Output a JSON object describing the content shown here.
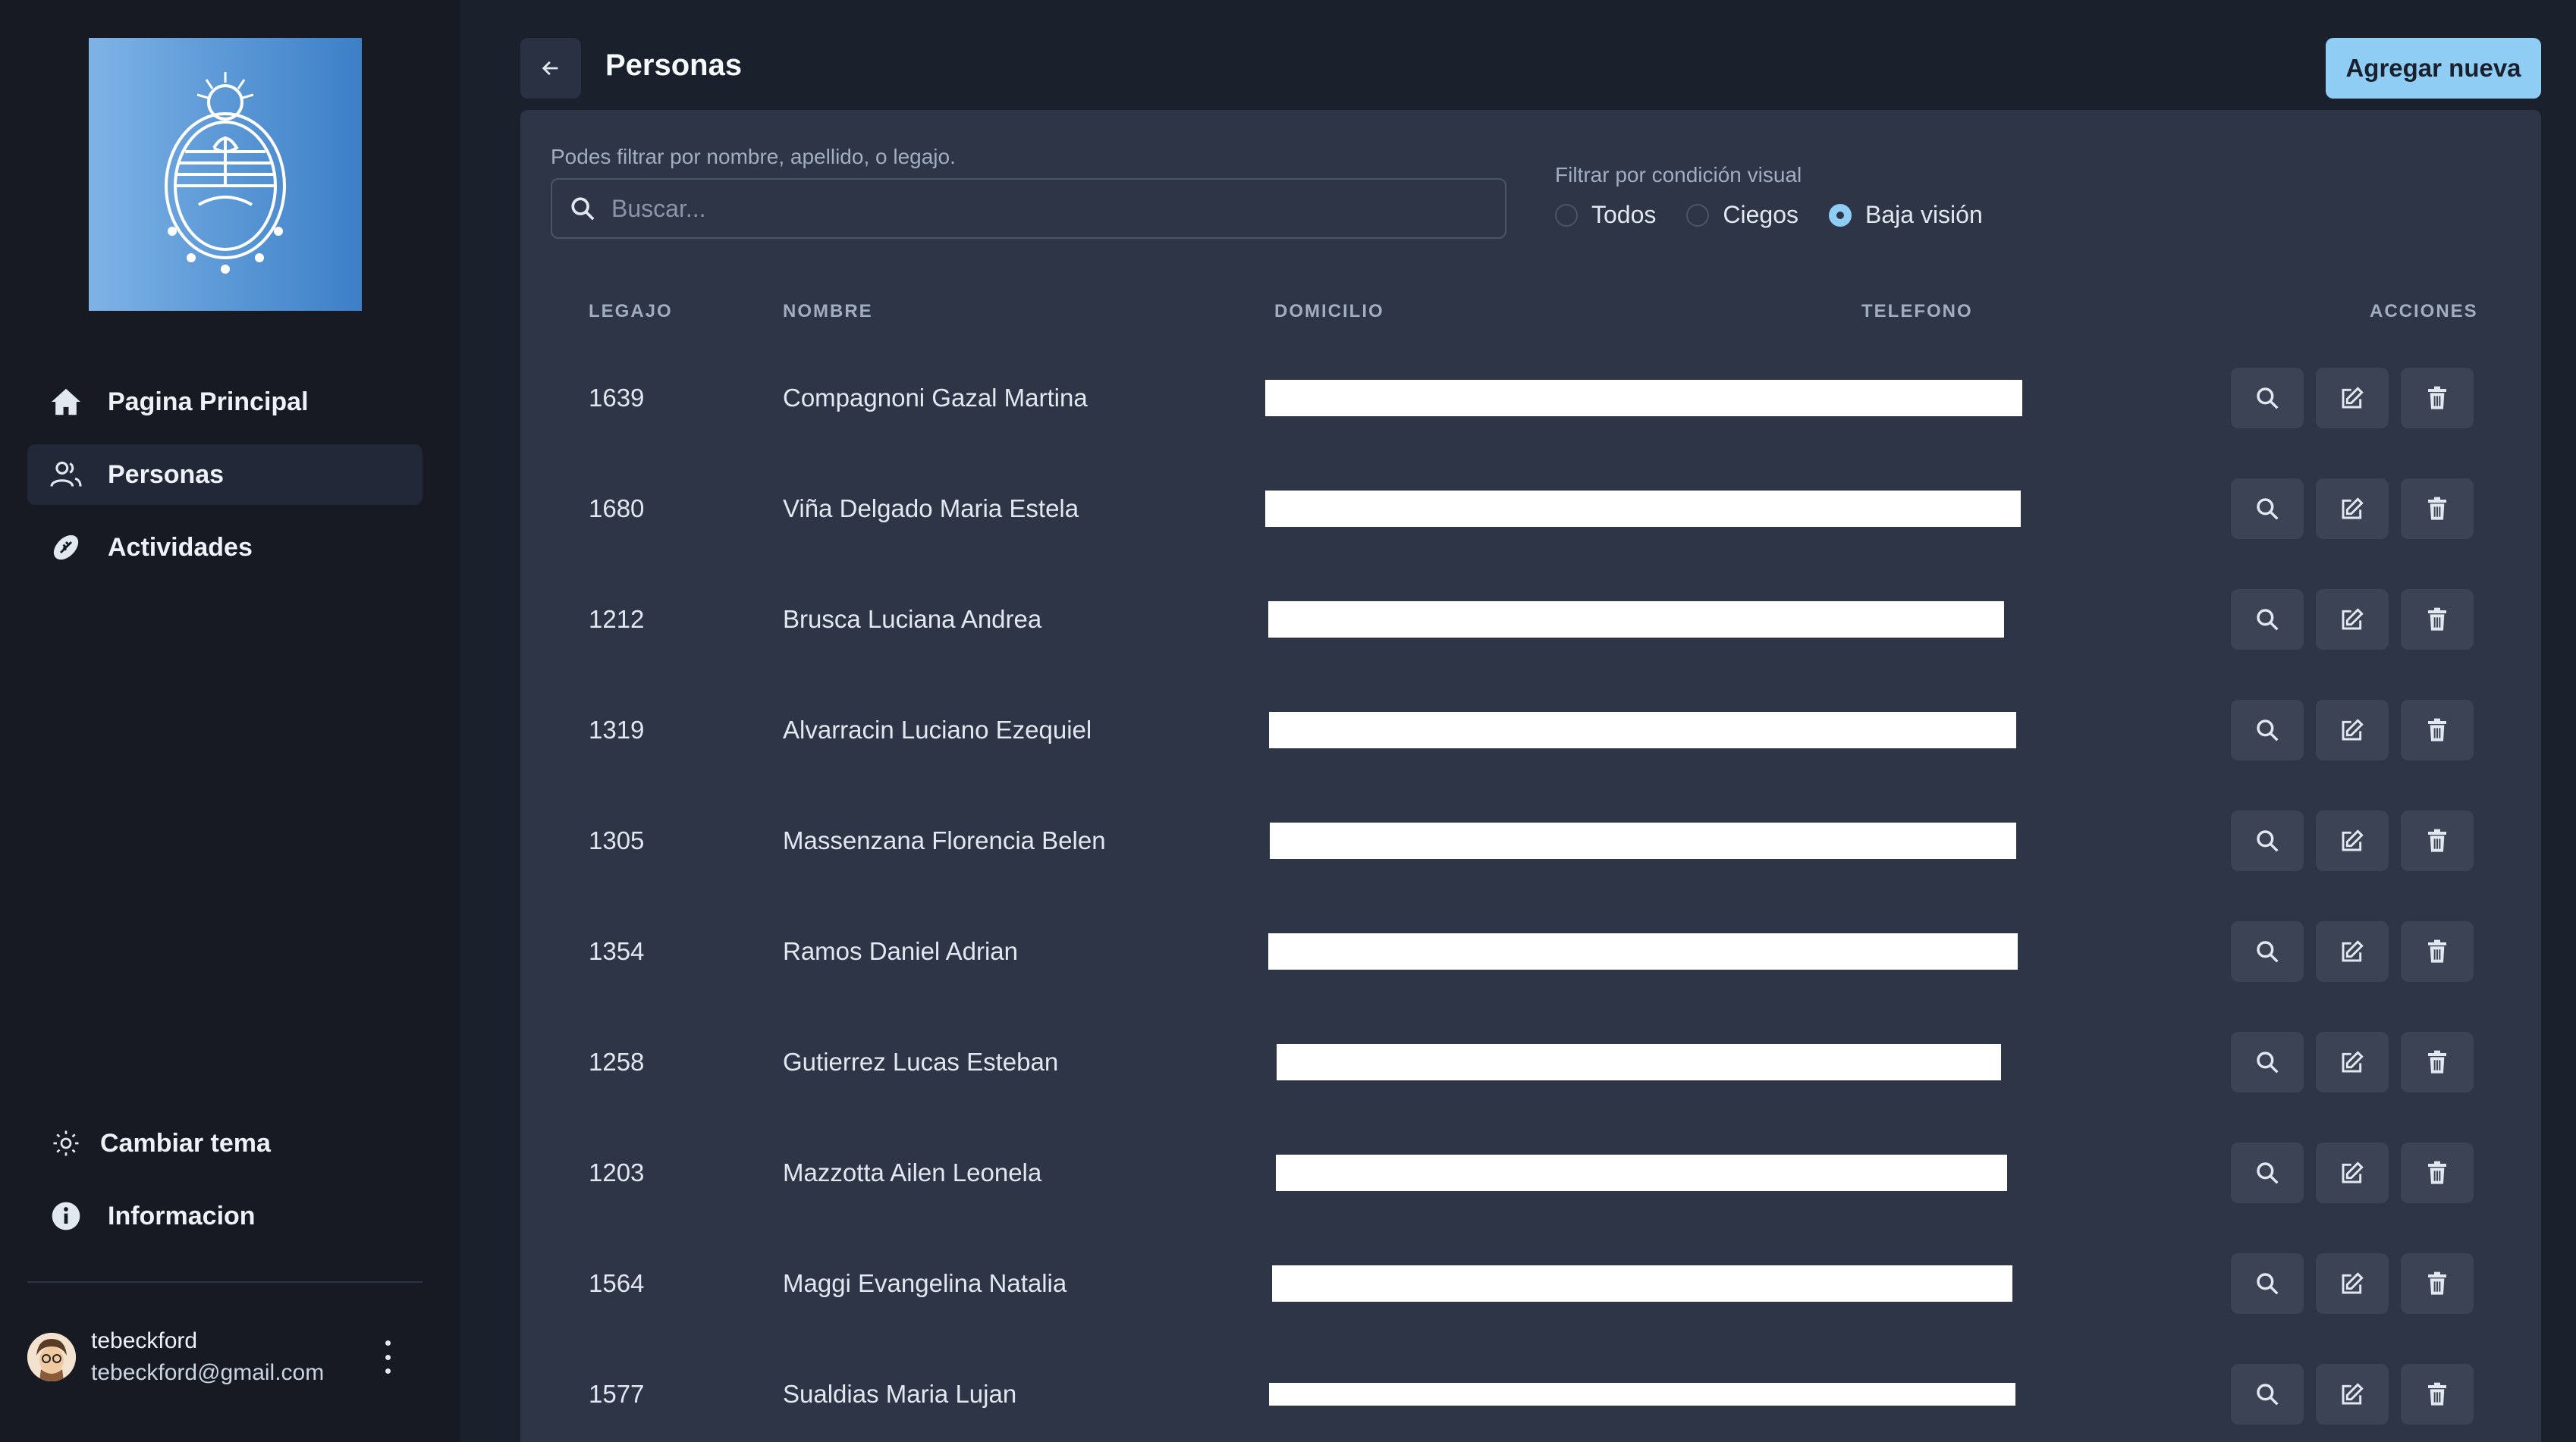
{
  "sidebar": {
    "nav": [
      {
        "label": "Pagina Principal",
        "icon": "home-icon",
        "active": false
      },
      {
        "label": "Personas",
        "icon": "users-icon",
        "active": true
      },
      {
        "label": "Actividades",
        "icon": "football-icon",
        "active": false
      }
    ],
    "bottom": [
      {
        "label": "Cambiar tema",
        "icon": "sun-icon"
      },
      {
        "label": "Informacion",
        "icon": "info-icon"
      }
    ],
    "user": {
      "name": "tebeckford",
      "email": "tebeckford@gmail.com"
    }
  },
  "header": {
    "title": "Personas",
    "add_label": "Agregar nueva"
  },
  "filters": {
    "hint": "Podes filtrar por nombre, apellido, o legajo.",
    "search_placeholder": "Buscar...",
    "visual_label": "Filtrar por condición visual",
    "options": [
      {
        "label": "Todos",
        "checked": false
      },
      {
        "label": "Ciegos",
        "checked": false
      },
      {
        "label": "Baja visión",
        "checked": true
      }
    ]
  },
  "table": {
    "columns": {
      "legajo": "LEGAJO",
      "nombre": "NOMBRE",
      "domicilio": "DOMICILIO",
      "telefono": "TELEFONO",
      "acciones": "ACCIONES"
    },
    "rows": [
      {
        "legajo": "1639",
        "nombre": "Compagnoni Gazal Martina"
      },
      {
        "legajo": "1680",
        "nombre": "Viña Delgado Maria Estela"
      },
      {
        "legajo": "1212",
        "nombre": "Brusca Luciana Andrea"
      },
      {
        "legajo": "1319",
        "nombre": "Alvarracin Luciano Ezequiel"
      },
      {
        "legajo": "1305",
        "nombre": "Massenzana Florencia Belen"
      },
      {
        "legajo": "1354",
        "nombre": "Ramos Daniel Adrian"
      },
      {
        "legajo": "1258",
        "nombre": "Gutierrez Lucas Esteban"
      },
      {
        "legajo": "1203",
        "nombre": "Mazzotta Ailen Leonela"
      },
      {
        "legajo": "1564",
        "nombre": "Maggi Evangelina Natalia"
      },
      {
        "legajo": "1577",
        "nombre": "Sualdias Maria Lujan"
      }
    ]
  },
  "colors": {
    "accent": "#90cdf4",
    "panel": "#2d3546",
    "sidebar": "#171923"
  }
}
